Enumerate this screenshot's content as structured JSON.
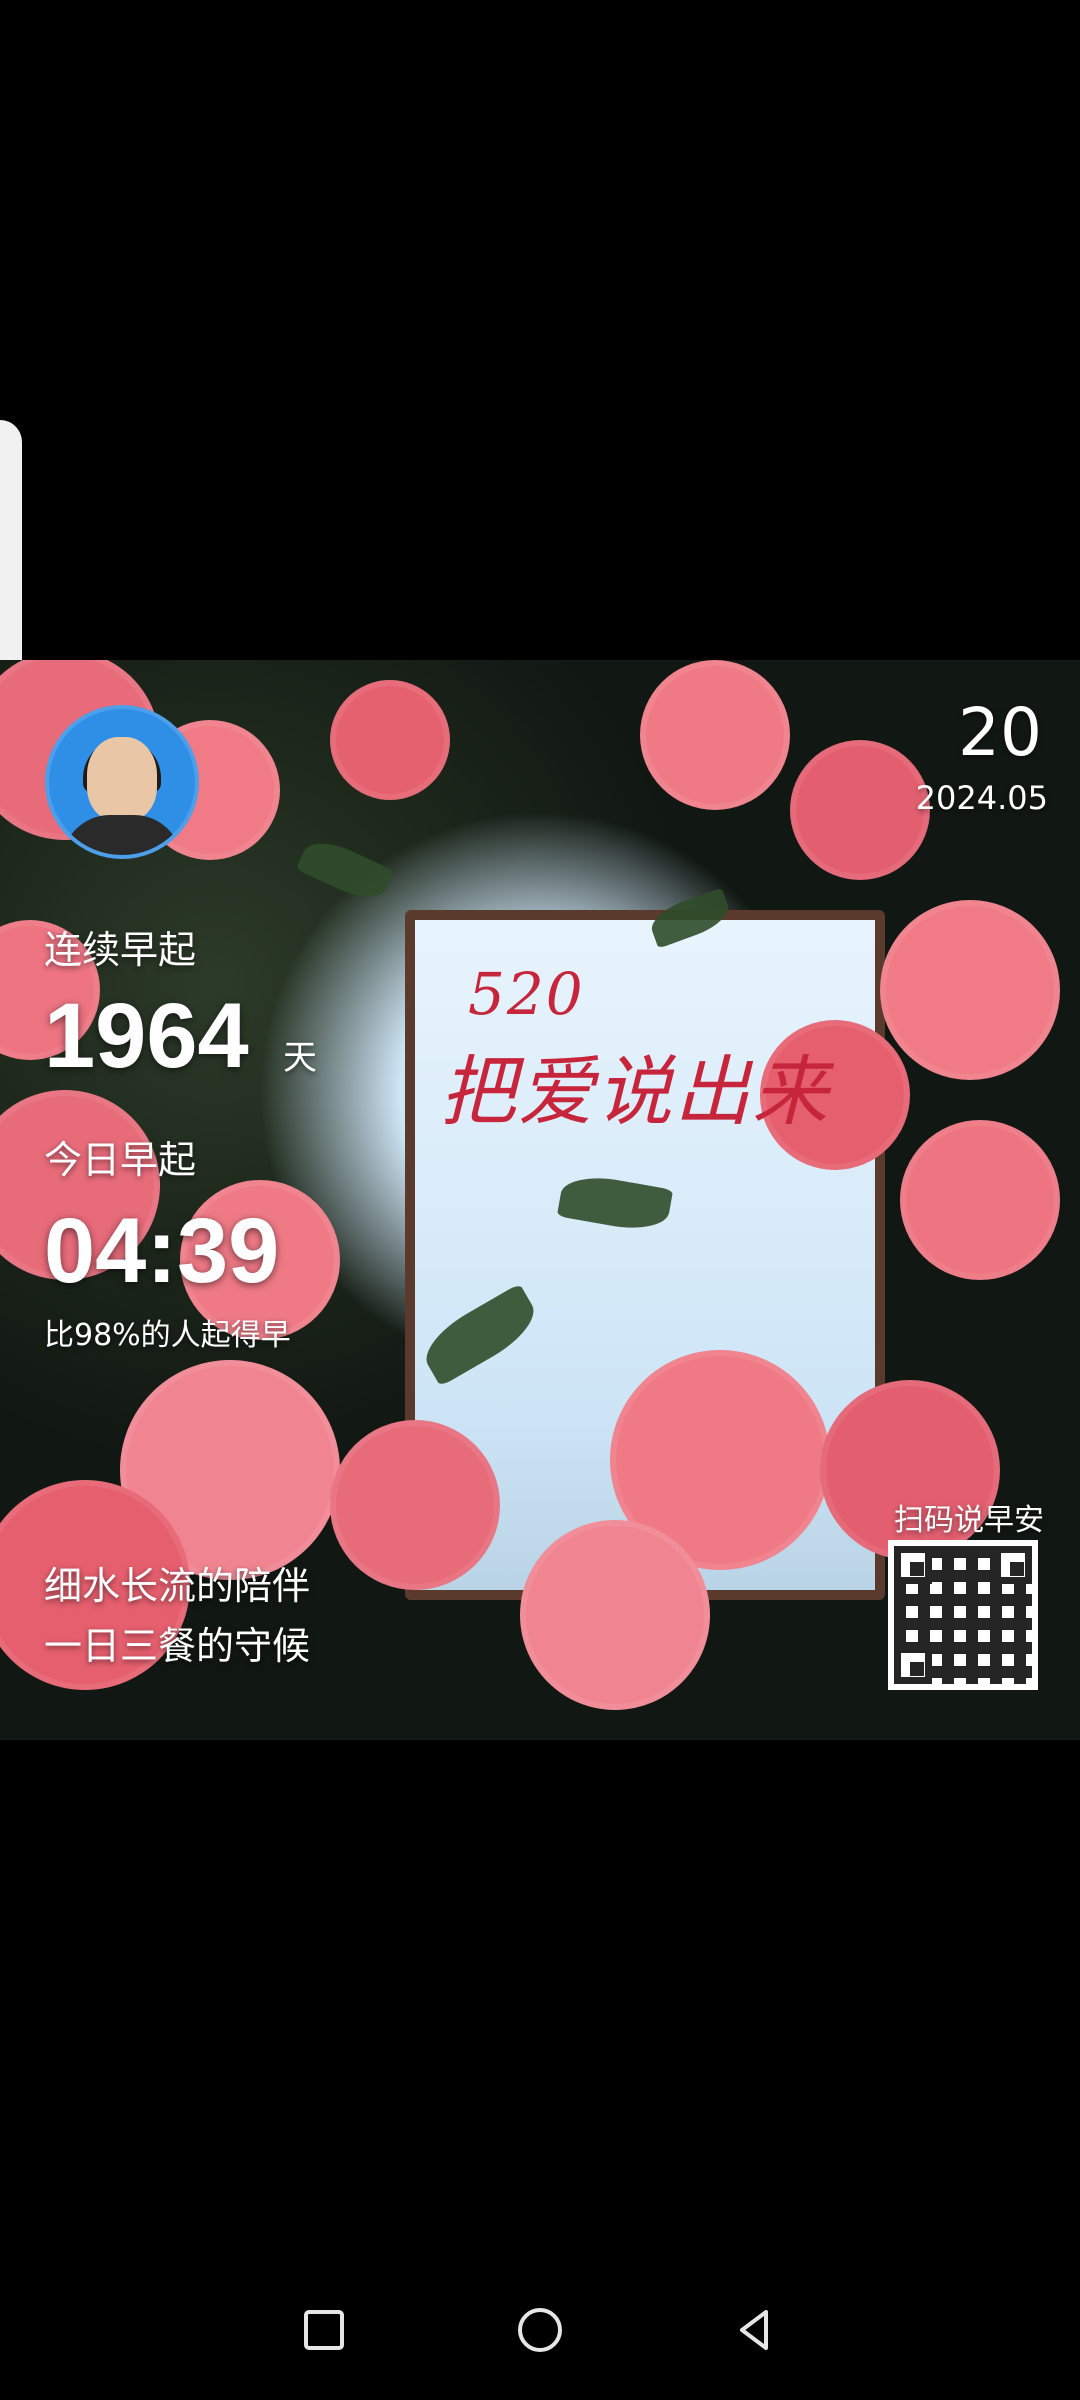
{
  "card": {
    "date_day": "20",
    "date_ym": "2024.05",
    "streak_label": "连续早起",
    "streak_value": "1964",
    "streak_unit": "天",
    "today_label": "今日早起",
    "today_time": "04:39",
    "rank_text": "比98%的人起得早",
    "slogan_line1": "细水长流的陪伴",
    "slogan_line2": "一日三餐的守候",
    "center_number": "520",
    "center_title": "把爱说出来",
    "qr_caption": "扫码说早安"
  },
  "icons": {
    "recent_apps": "square-icon",
    "home": "circle-icon",
    "back": "triangle-back-icon",
    "avatar": "avatar-icon",
    "qr": "qr-code-icon"
  },
  "colors": {
    "background": "#000000",
    "rose": "#e86b7a",
    "accent_red": "#c7253b"
  }
}
